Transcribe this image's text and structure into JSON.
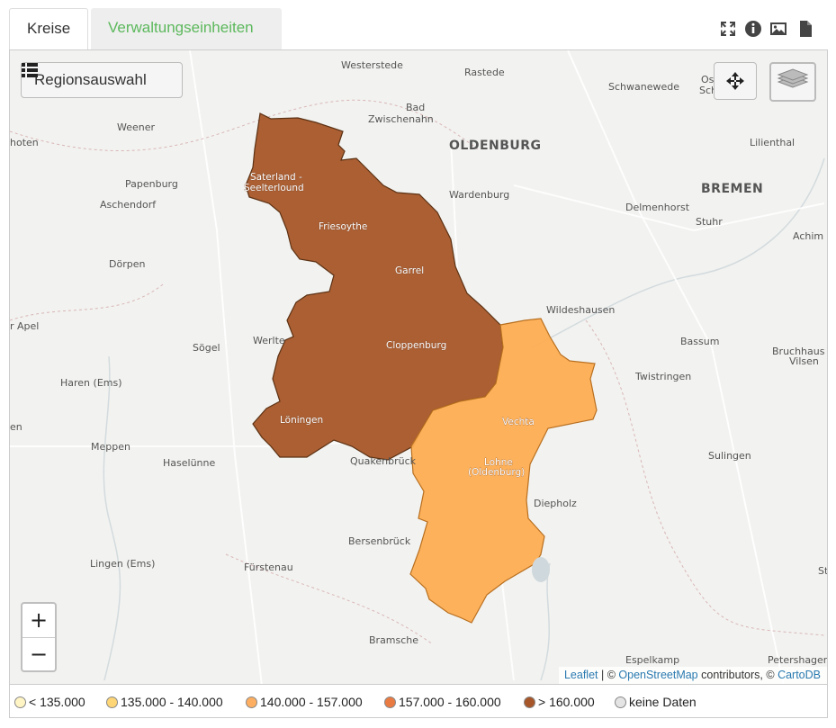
{
  "tabs": {
    "active": "Kreise",
    "other": "Verwaltungseinheiten"
  },
  "toolbar": {
    "icons": [
      "fullscreen-icon",
      "info-icon",
      "image-icon",
      "file-icon"
    ]
  },
  "map": {
    "region_button_label": "Regionsauswahl",
    "zoom_in": "+",
    "zoom_out": "−",
    "places": {
      "westerstede": "Westerstede",
      "rastede": "Rastede",
      "schwanewede": "Schwanewede",
      "os": "Os",
      "sch": "Sch",
      "bad": "Bad",
      "zwischenahn": "Zwischenahn",
      "oldenburg": "OLDENBURG",
      "lilienthal": "Lilienthal",
      "weener": "Weener",
      "hoten": "hoten",
      "bremen": "BREMEN",
      "papenburg": "Papenburg",
      "wardenburg": "Wardenburg",
      "delmenhorst": "Delmenhorst",
      "aschendorf": "Aschendorf",
      "stuhr": "Stuhr",
      "achim": "Achim",
      "doerpen": "Dörpen",
      "wildeshausen": "Wildeshausen",
      "r_apel": "r Apel",
      "soegel": "Sögel",
      "werlte": "Werlte",
      "bassum": "Bassum",
      "bruchhausen": "Bruchhaus",
      "vilsen": "Vilsen",
      "haren": "Haren (Ems)",
      "twistringen": "Twistringen",
      "en": "en",
      "meppen": "Meppen",
      "haseluenne": "Haselünne",
      "quakenbrueck": "Quakenbrück",
      "sulingen": "Sulingen",
      "diepholz": "Diepholz",
      "bersenbrueck": "Bersenbrück",
      "lingen": "Lingen (Ems)",
      "fuerstenau": "Fürstenau",
      "st": "St",
      "bramsche": "Bramsche",
      "espelkamp": "Espelkamp",
      "petershagen": "Petershager"
    },
    "region_labels": {
      "saterland_1": "Saterland -",
      "saterland_2": "Seelterlound",
      "friesoythe": "Friesoythe",
      "garrel": "Garrel",
      "cloppenburg": "Cloppenburg",
      "loeningen": "Löningen",
      "vechta": "Vechta",
      "lohne_1": "Lohne",
      "lohne_2": "(Oldenburg)"
    },
    "regions": [
      {
        "name": "Cloppenburg",
        "color": "#a65628"
      },
      {
        "name": "Vechta",
        "color": "#fdad52"
      }
    ],
    "attribution": {
      "leaflet": "Leaflet",
      "sep": " | © ",
      "osm": "OpenStreetMap",
      "contributors": " contributors, © ",
      "carto": "CartoDB"
    }
  },
  "legend": [
    {
      "label": "< 135.000",
      "color": "#fff5c4"
    },
    {
      "label": "135.000 - 140.000",
      "color": "#fed676"
    },
    {
      "label": "140.000 - 157.000",
      "color": "#fdae61"
    },
    {
      "label": "157.000 - 160.000",
      "color": "#e97b42"
    },
    {
      "label": "> 160.000",
      "color": "#a65628"
    },
    {
      "label": "keine Daten",
      "color": "#e4e4e4"
    }
  ]
}
